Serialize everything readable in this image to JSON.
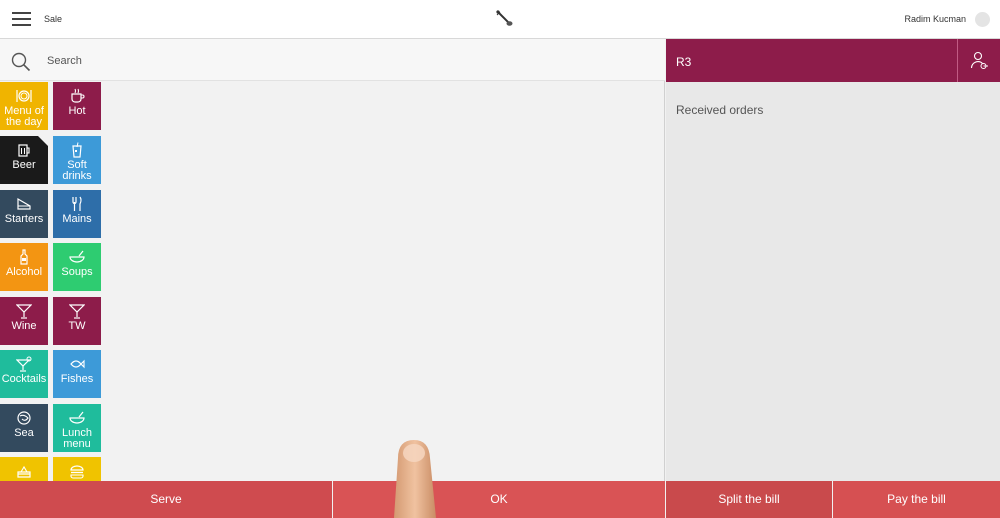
{
  "topbar": {
    "title": "Sale",
    "user_name": "Radim Kucman",
    "logo_icon": "guitar-logo-icon",
    "menu_icon": "hamburger-menu-icon"
  },
  "search": {
    "placeholder": "Search",
    "icon": "search-icon"
  },
  "categories": [
    {
      "id": "menu-of-the-day",
      "label": "Menu of the day",
      "color": "#f0b400",
      "icon": "plate-cutlery-icon"
    },
    {
      "id": "hot",
      "label": "Hot",
      "color": "#8d1c4a",
      "icon": "coffee-cup-icon"
    },
    {
      "id": "beer",
      "label": "Beer",
      "color": "#1a1a1a",
      "icon": "beer-mug-icon"
    },
    {
      "id": "soft-drinks",
      "label": "Soft drinks",
      "color": "#3d9ad8",
      "icon": "soda-glass-icon"
    },
    {
      "id": "starters",
      "label": "Starters",
      "color": "#334a5e",
      "icon": "cheese-slice-icon"
    },
    {
      "id": "mains",
      "label": "Mains",
      "color": "#2e6ea9",
      "icon": "fork-knife-icon"
    },
    {
      "id": "alcohol",
      "label": "Alcohol",
      "color": "#f39512",
      "icon": "bottle-icon"
    },
    {
      "id": "soups",
      "label": "Soups",
      "color": "#2ecc71",
      "icon": "soup-bowl-icon"
    },
    {
      "id": "wine",
      "label": "Wine",
      "color": "#8d1c4a",
      "icon": "martini-glass-icon"
    },
    {
      "id": "tw",
      "label": "TW",
      "color": "#8d1c4a",
      "icon": "martini-glass-icon"
    },
    {
      "id": "cocktails",
      "label": "Cocktails",
      "color": "#1fbc9c",
      "icon": "cocktail-icon"
    },
    {
      "id": "fishes",
      "label": "Fishes",
      "color": "#3d9ad8",
      "icon": "fish-icon"
    },
    {
      "id": "sea",
      "label": "Sea",
      "color": "#334a5e",
      "icon": "shell-icon"
    },
    {
      "id": "lunch-menu",
      "label": "Lunch menu",
      "color": "#1fbc9c",
      "icon": "soup-bowl-icon"
    },
    {
      "id": "partial-1",
      "label": "",
      "color": "#f0c300",
      "icon": "cake-icon"
    },
    {
      "id": "partial-2",
      "label": "",
      "color": "#f0c300",
      "icon": "burger-icon"
    }
  ],
  "order": {
    "name": "R3",
    "customer_icon": "customer-add-icon",
    "received_label": "Received orders"
  },
  "actions": {
    "serve": "Serve",
    "ok": "OK",
    "split": "Split the bill",
    "pay": "Pay the bill"
  },
  "colors": {
    "accent": "#8d1c4a",
    "action": "#d65052"
  }
}
